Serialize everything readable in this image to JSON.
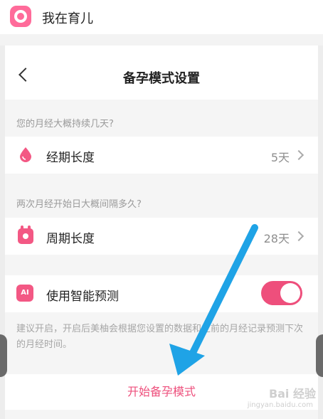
{
  "app_header": {
    "title": "我在育儿"
  },
  "nav": {
    "title": "备孕模式设置"
  },
  "period": {
    "hint": "您的月经大概持续几天?",
    "label": "经期长度",
    "value": "5天"
  },
  "cycle": {
    "hint": "两次月经开始日大概间隔多久?",
    "label": "周期长度",
    "value": "28天"
  },
  "smart_predict": {
    "label": "使用智能预测",
    "icon_text": "AI",
    "enabled": true,
    "description": "建议开启，开启后美柚会根据您设置的数据和之前的月经记录预测下次的月经时间。"
  },
  "start_button": {
    "label": "开始备孕模式"
  },
  "watermark": {
    "text": "Bai 经验",
    "sub": "jingyan.baidu.com"
  },
  "colors": {
    "accent": "#ee4f7c",
    "arrow": "#1fa3e6"
  }
}
